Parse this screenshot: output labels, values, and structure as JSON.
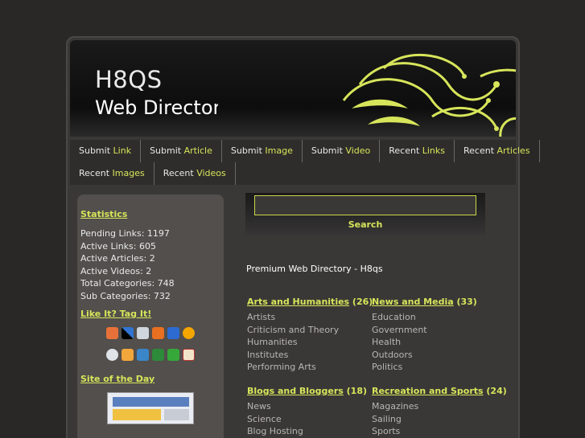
{
  "header": {
    "title": "H8QS",
    "subtitle": "Web Directory"
  },
  "nav": {
    "row1": [
      {
        "pre": "Submit ",
        "hl": "Link"
      },
      {
        "pre": "Submit ",
        "hl": "Article"
      },
      {
        "pre": "Submit ",
        "hl": "Image"
      },
      {
        "pre": "Submit ",
        "hl": "Video"
      },
      {
        "pre": "Recent ",
        "hl": "Links"
      },
      {
        "pre": "Recent ",
        "hl": "Articles"
      }
    ],
    "row2": [
      {
        "pre": "Recent ",
        "hl": "Images"
      },
      {
        "pre": "Recent ",
        "hl": "Videos"
      }
    ]
  },
  "sidebar": {
    "statistics_heading": "Statistics",
    "stats": [
      "Pending Links: 1197",
      "Active Links: 605",
      "Active Articles: 2",
      "Active Videos: 2",
      "Total Categories: 748",
      "Sub Categories: 732"
    ],
    "tag_heading": "Like It? Tag It!",
    "site_of_day_heading": "Site of the Day"
  },
  "search": {
    "value": "",
    "button_label": "Search"
  },
  "main": {
    "tagline": "Premium Web Directory - H8qs",
    "categories": [
      {
        "name": "Arts and Humanities",
        "count": "(26)",
        "subs": [
          "Artists",
          "Criticism and Theory",
          "Humanities",
          "Institutes",
          "Performing Arts"
        ]
      },
      {
        "name": "News and Media",
        "count": "(33)",
        "subs": [
          "Education",
          "Government",
          "Health",
          "Outdoors",
          "Politics"
        ]
      },
      {
        "name": "Blogs and Bloggers",
        "count": "(18)",
        "subs": [
          "News",
          "Science",
          "Blog Hosting"
        ]
      },
      {
        "name": "Recreation and Sports",
        "count": "(24)",
        "subs": [
          "Magazines",
          "Sailing",
          "Sports"
        ]
      }
    ]
  },
  "colors": {
    "accent": "#d7e55a",
    "background": "#2a2826",
    "sidebar": "#524f4c"
  },
  "icons": {
    "row1": [
      "bookmark-icon",
      "delicious-icon",
      "digg-icon",
      "furl-icon",
      "google-icon",
      "sun-icon"
    ],
    "row2": [
      "reddit-icon",
      "blinklist-icon",
      "spurl-icon",
      "stumbleupon-icon",
      "technorati-icon",
      "yahoo-icon"
    ]
  }
}
